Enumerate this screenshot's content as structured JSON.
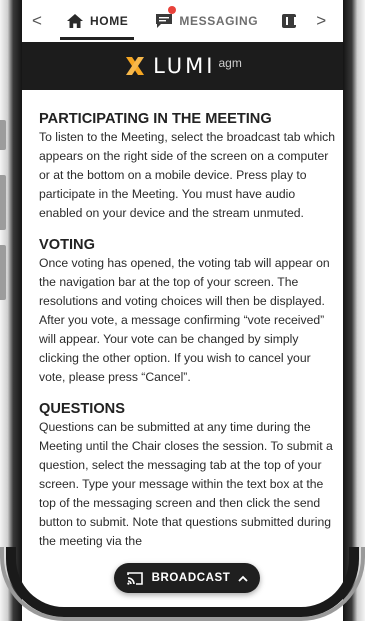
{
  "tabs": {
    "prev_arrow": "<",
    "next_arrow": ">",
    "home_label": "HOME",
    "messaging_label": "MESSAGING",
    "messaging_has_notification": true
  },
  "brand": {
    "name": "LUMI",
    "suffix": "agm",
    "accent_color": "#f5a623",
    "bar_color": "#1c1c1c"
  },
  "sections": [
    {
      "title": "PARTICIPATING IN THE MEETING",
      "body": "To listen to the Meeting, select the broadcast tab which appears on the right side of the screen on a computer or at the bottom on a mobile device. Press play to participate in the Meeting. You must have audio enabled on your device and the stream unmuted."
    },
    {
      "title": "VOTING",
      "body": "Once voting has opened, the voting tab will appear on the navigation bar at the top of your screen. The resolutions and voting choices will then be displayed. After you vote, a message confirming “vote received” will appear. Your vote can be changed by simply clicking the other option. If you wish to cancel your vote, please press “Cancel”."
    },
    {
      "title": "QUESTIONS",
      "body": "Questions can be submitted at any time during the Meeting until the Chair closes the session. To submit a question, select the messaging tab at the top of your screen. Type your message within the text box at the top of the messaging screen and then click the send button to submit. Note that questions submitted during the meeting via the"
    }
  ],
  "broadcast": {
    "label": "BROADCAST",
    "icon": "cast-icon",
    "chevron": "chevron-up-icon"
  },
  "colors": {
    "notification_badge": "#e8423b",
    "text": "#2b2b2b",
    "pill": "#1f1f1f"
  }
}
